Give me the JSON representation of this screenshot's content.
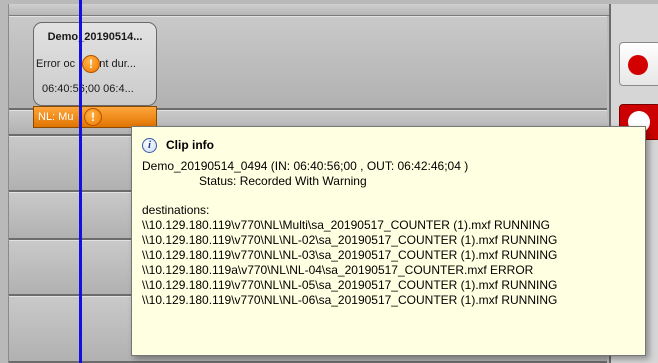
{
  "timeline": {
    "clip_warning": {
      "title": "Demo_20190514...",
      "status_text": "Error oc",
      "status_text_tail": "ent dur...",
      "timecode": "06:40:56;00  06:4..."
    },
    "clip_multi": {
      "label": "NL: Mu"
    },
    "warning_glyph": "!"
  },
  "tooltip": {
    "title": "Clip info",
    "info_glyph": "i",
    "clip_line": "Demo_20190514_0494 (IN: 06:40:56;00  , OUT: 06:42:46;04 )",
    "status_line": "Status: Recorded With Warning",
    "destinations_label": "destinations:",
    "destinations": [
      "\\\\10.129.180.119\\v770\\NL\\Multi\\sa_20190517_COUNTER (1).mxf RUNNING",
      "\\\\10.129.180.119\\v770\\NL\\NL-02\\sa_20190517_COUNTER (1).mxf RUNNING",
      "\\\\10.129.180.119\\v770\\NL\\NL-03\\sa_20190517_COUNTER (1).mxf RUNNING",
      "\\\\10.129.180.119a\\v770\\NL\\NL-04\\sa_20190517_COUNTER.mxf ERROR",
      "\\\\10.129.180.119\\v770\\NL\\NL-05\\sa_20190517_COUNTER (1).mxf RUNNING",
      "\\\\10.129.180.119\\v770\\NL\\NL-06\\sa_20190517_COUNTER (1).mxf RUNNING"
    ]
  },
  "colors": {
    "playhead": "#1010e0",
    "tooltip_bg": "#ffffe1",
    "warning": "#f07800",
    "record": "#d20000"
  },
  "icons": [
    "warning-icon",
    "info-icon",
    "record-icon"
  ]
}
